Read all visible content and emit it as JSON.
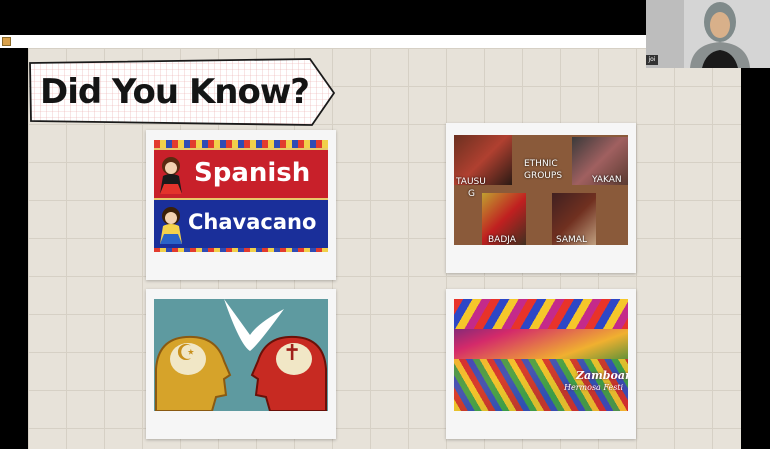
{
  "slide": {
    "title": "Did You Know?"
  },
  "cards": {
    "languages": {
      "spanish": "Spanish",
      "chavacano": "Chavacano"
    },
    "ethnic": {
      "heading_line1": "ETHNIC",
      "heading_line2": "GROUPS",
      "tausug_1": "TAUSU",
      "tausug_2": "G",
      "yakan": "YAKAN",
      "badjao": "BADJA",
      "samal": "SAMAL"
    },
    "festival": {
      "caption_1": "Zamboan",
      "caption_2": "Hermosa Festi"
    },
    "religion": {
      "left_symbol": "☪",
      "right_symbol": "✝"
    }
  },
  "webcam": {
    "name_tag": "joi"
  },
  "colors": {
    "spanish_red": "#c8202a",
    "chavacano_blue": "#1a2f9a",
    "slide_bg": "#e7e2d9",
    "religion_bg": "#5e9aa0",
    "gold_head": "#d6a32a",
    "red_head": "#c72a22"
  }
}
